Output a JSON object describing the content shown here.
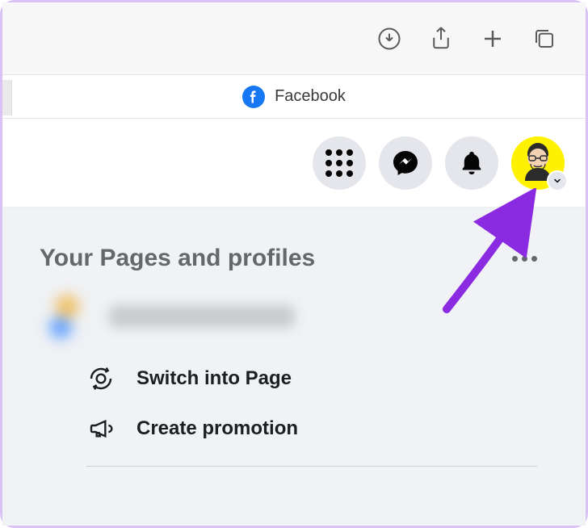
{
  "browser": {
    "site_title": "Facebook"
  },
  "header_icons": {
    "menu": "menu-grid-icon",
    "messenger": "messenger-icon",
    "notifications": "bell-icon",
    "avatar": "profile-avatar"
  },
  "pages_panel": {
    "title": "Your Pages and profiles",
    "actions": [
      {
        "label": "Switch into Page"
      },
      {
        "label": "Create promotion"
      }
    ]
  },
  "colors": {
    "fb_blue": "#1877f2",
    "gray_bg": "#e4e6eb",
    "content_bg": "#f0f2f5",
    "text_primary": "#1c1e21",
    "text_secondary": "#65676b",
    "avatar_yellow": "#fff200",
    "annotation": "#8a2be2"
  }
}
